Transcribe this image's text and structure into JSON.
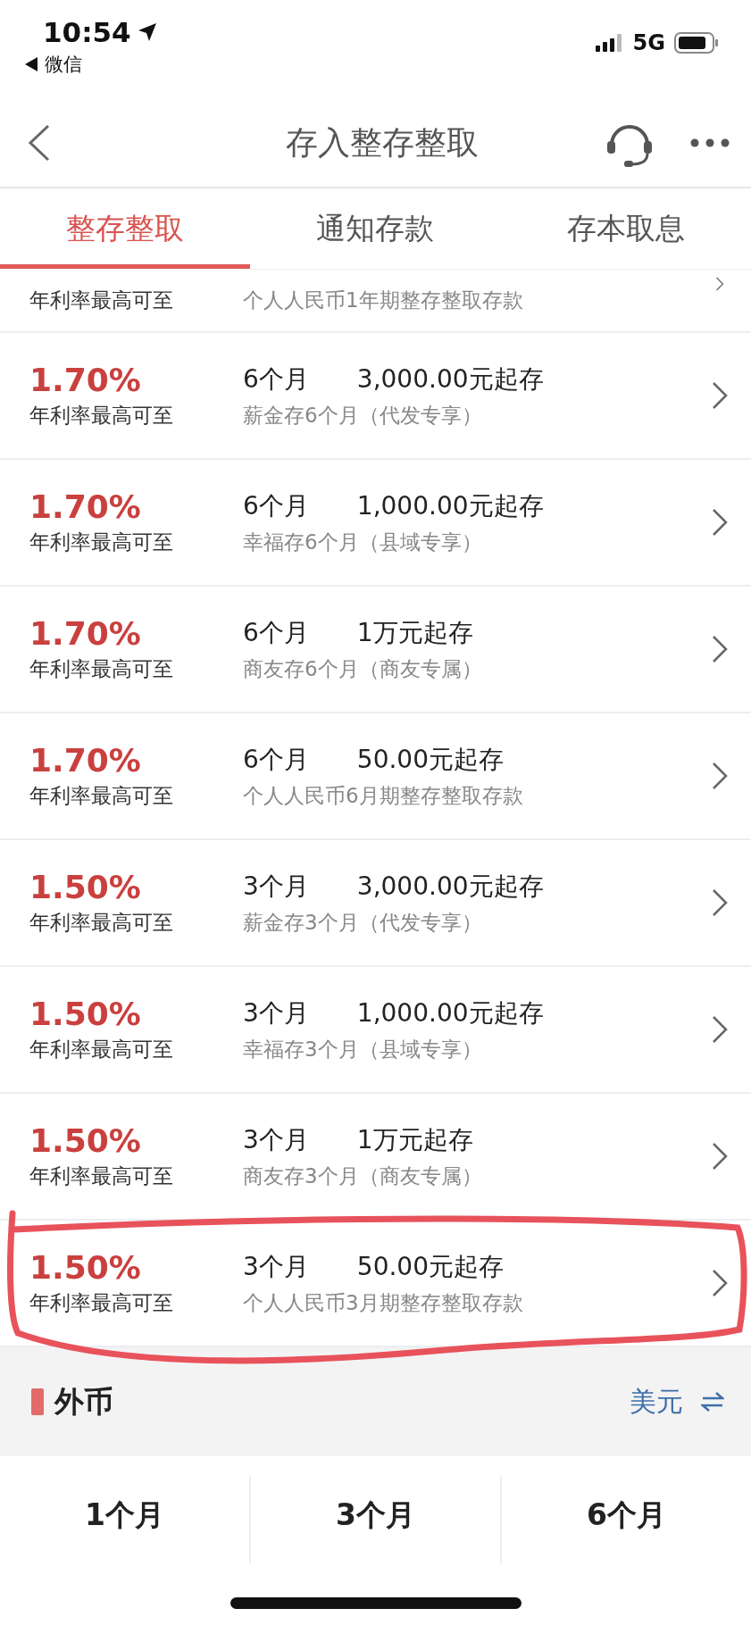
{
  "status_bar": {
    "time": "10:54",
    "back_label": "微信",
    "network": "5G"
  },
  "nav": {
    "title": "存入整存整取"
  },
  "tabs": [
    {
      "label": "整存整取",
      "selected": true
    },
    {
      "label": "通知存款",
      "selected": false
    },
    {
      "label": "存本取息",
      "selected": false
    }
  ],
  "products": [
    {
      "kind": "partial",
      "label": "年利率最高可至",
      "description": "个人人民币1年期整存整取存款",
      "circled": false
    },
    {
      "kind": "full",
      "rate": "1.70%",
      "label": "年利率最高可至",
      "term": "6个月",
      "minimum": "3,000.00元起存",
      "description": "薪金存6个月（代发专享）",
      "circled": false
    },
    {
      "kind": "full",
      "rate": "1.70%",
      "label": "年利率最高可至",
      "term": "6个月",
      "minimum": "1,000.00元起存",
      "description": "幸福存6个月（县域专享）",
      "circled": false
    },
    {
      "kind": "full",
      "rate": "1.70%",
      "label": "年利率最高可至",
      "term": "6个月",
      "minimum": "1万元起存",
      "description": "商友存6个月（商友专属）",
      "circled": false
    },
    {
      "kind": "full",
      "rate": "1.70%",
      "label": "年利率最高可至",
      "term": "6个月",
      "minimum": "50.00元起存",
      "description": "个人人民币6月期整存整取存款",
      "circled": false
    },
    {
      "kind": "full",
      "rate": "1.50%",
      "label": "年利率最高可至",
      "term": "3个月",
      "minimum": "3,000.00元起存",
      "description": "薪金存3个月（代发专享）",
      "circled": false
    },
    {
      "kind": "full",
      "rate": "1.50%",
      "label": "年利率最高可至",
      "term": "3个月",
      "minimum": "1,000.00元起存",
      "description": "幸福存3个月（县域专享）",
      "circled": false
    },
    {
      "kind": "full",
      "rate": "1.50%",
      "label": "年利率最高可至",
      "term": "3个月",
      "minimum": "1万元起存",
      "description": "商友存3个月（商友专属）",
      "circled": false
    },
    {
      "kind": "full",
      "rate": "1.50%",
      "label": "年利率最高可至",
      "term": "3个月",
      "minimum": "50.00元起存",
      "description": "个人人民币3月期整存整取存款",
      "circled": true
    }
  ],
  "foreign": {
    "title": "外币",
    "currency": "美元",
    "terms": [
      "1个月",
      "3个月",
      "6个月"
    ]
  }
}
